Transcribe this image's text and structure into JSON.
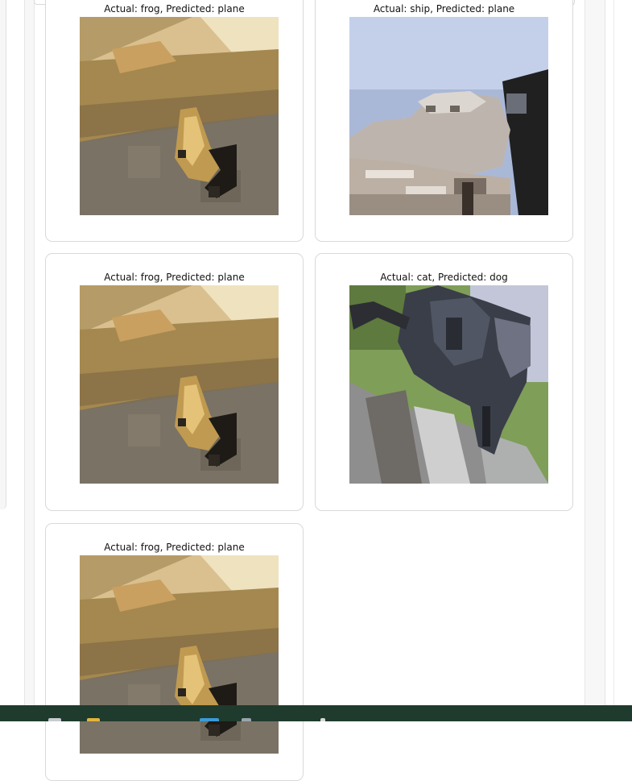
{
  "cards": [
    {
      "caption": "Actual: frog, Predicted: plane",
      "actual": "frog",
      "predicted": "plane"
    },
    {
      "caption": "Actual: ship, Predicted: plane",
      "actual": "ship",
      "predicted": "plane"
    },
    {
      "caption": "Actual: frog, Predicted: plane",
      "actual": "frog",
      "predicted": "plane"
    },
    {
      "caption": "Actual: cat, Predicted: dog",
      "actual": "cat",
      "predicted": "dog"
    },
    {
      "caption": "Actual: frog, Predicted: plane",
      "actual": "frog",
      "predicted": "plane"
    }
  ],
  "taskbar": {
    "icons": [
      "start-icon",
      "file-explorer-icon",
      "window-icon",
      "browser-icon",
      "app-icon"
    ]
  },
  "colors": {
    "taskbar": "#1f3b2d",
    "card_border": "#d9d9d9"
  }
}
